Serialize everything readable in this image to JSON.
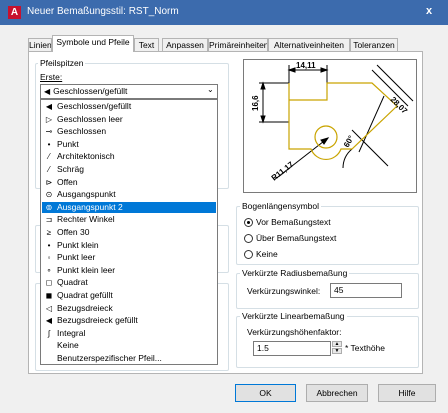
{
  "window": {
    "title": "Neuer Bemaßungsstil: RST_Norm",
    "close_label": "x",
    "app_icon_letter": "A"
  },
  "tabs": [
    "Linien",
    "Symbole und Pfeile",
    "Text",
    "Anpassen",
    "Primäreinheiten",
    "Alternativeinheiten",
    "Toleranzen"
  ],
  "arrowheads": {
    "group_title": "Pfeilspitzen",
    "first_label": "Erste:",
    "first_value": "Geschlossen/gefüllt",
    "list": [
      {
        "label": "Geschlossen/gefüllt",
        "icon": "closed-filled-arrow-icon",
        "glyph": "◀"
      },
      {
        "label": "Geschlossen leer",
        "icon": "closed-blank-arrow-icon",
        "glyph": "▷"
      },
      {
        "label": "Geschlossen",
        "icon": "closed-arrow-icon",
        "glyph": "⊸"
      },
      {
        "label": "Punkt",
        "icon": "dot-arrow-icon",
        "glyph": "•"
      },
      {
        "label": "Architektonisch",
        "icon": "architectural-tick-icon",
        "glyph": "⁄"
      },
      {
        "label": "Schräg",
        "icon": "oblique-icon",
        "glyph": "⁄"
      },
      {
        "label": "Offen",
        "icon": "open-arrow-icon",
        "glyph": "⊳"
      },
      {
        "label": "Ausgangspunkt",
        "icon": "origin-indicator-icon",
        "glyph": "⊙"
      },
      {
        "label": "Ausgangspunkt 2",
        "icon": "origin-indicator-2-icon",
        "glyph": "⊚"
      },
      {
        "label": "Rechter Winkel",
        "icon": "right-angle-icon",
        "glyph": "⊐"
      },
      {
        "label": "Offen 30",
        "icon": "open-30-icon",
        "glyph": "≥"
      },
      {
        "label": "Punkt klein",
        "icon": "dot-small-icon",
        "glyph": "•"
      },
      {
        "label": "Punkt leer",
        "icon": "dot-blank-icon",
        "glyph": "◦"
      },
      {
        "label": "Punkt klein leer",
        "icon": "dot-small-blank-icon",
        "glyph": "∘"
      },
      {
        "label": "Quadrat",
        "icon": "box-icon",
        "glyph": "◻"
      },
      {
        "label": "Quadrat gefüllt",
        "icon": "box-filled-icon",
        "glyph": "◼"
      },
      {
        "label": "Bezugsdreieck",
        "icon": "datum-triangle-icon",
        "glyph": "◁"
      },
      {
        "label": "Bezugsdreieck gefüllt",
        "icon": "datum-triangle-filled-icon",
        "glyph": "◀"
      },
      {
        "label": "Integral",
        "icon": "integral-icon",
        "glyph": "∫"
      },
      {
        "label": "Keine",
        "icon": "",
        "glyph": ""
      },
      {
        "label": "Benutzerspezifischer Pfeil...",
        "icon": "",
        "glyph": ""
      }
    ],
    "selected_index": 8
  },
  "preview": {
    "dim_top": "14,11",
    "dim_left": "16,6",
    "dim_right": "28,07",
    "dim_angle": "60°",
    "dim_radius": "R11,17"
  },
  "arc_length": {
    "title": "Bogenlängensymbol",
    "options": [
      "Vor Bemaßungstext",
      "Über Bemaßungstext",
      "Keine"
    ],
    "selected": 0
  },
  "jog_radius": {
    "title": "Verkürzte Radiusbemaßung",
    "label": "Verkürzungswinkel:",
    "value": "45"
  },
  "jog_linear": {
    "title": "Verkürzte Linearbemaßung",
    "label": "Verkürzungshöhenfaktor:",
    "value": "1.5",
    "unit": "* Texthöhe"
  },
  "buttons": {
    "ok": "OK",
    "cancel": "Abbrechen",
    "help": "Hilfe"
  }
}
